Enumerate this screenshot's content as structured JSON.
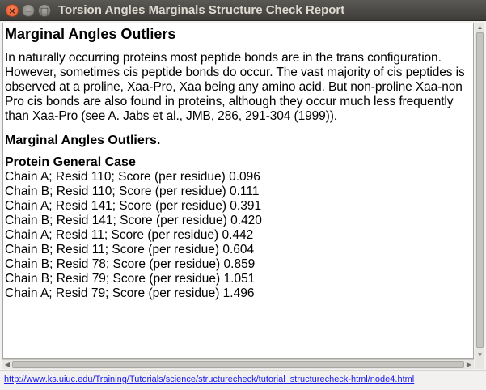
{
  "window": {
    "title": "Torsion Angles Marginals Structure Check Report"
  },
  "content": {
    "heading": "Marginal Angles Outliers",
    "paragraph": "In naturally occurring proteins most peptide bonds are in the trans configuration. However, sometimes cis peptide bonds do occur. The vast majority of cis peptides is observed at a proline, Xaa-Pro, Xaa being any amino acid. But non-proline Xaa-non Pro cis bonds are also found in proteins, although they occur much less frequently than Xaa-Pro (see A. Jabs et al., JMB, 286, 291-304 (1999)).",
    "subheading": "Marginal Angles Outliers.",
    "section_title": "Protein General Case",
    "outliers": [
      "Chain A; Resid 110; Score (per residue) 0.096",
      "Chain B; Resid 110; Score (per residue) 0.111",
      "Chain A; Resid 141; Score (per residue) 0.391",
      "Chain B; Resid 141; Score (per residue) 0.420",
      "Chain A; Resid 11; Score (per residue) 0.442",
      "Chain B; Resid 11; Score (per residue) 0.604",
      "Chain B; Resid 78; Score (per residue) 0.859",
      "Chain B; Resid 79; Score (per residue) 1.051",
      "Chain A; Resid 79; Score (per residue) 1.496"
    ]
  },
  "statusbar": {
    "link": "http://www.ks.uiuc.edu/Training/Tutorials/science/structurecheck/tutorial_structurecheck-html/node4.html"
  },
  "icons": {
    "close": "×",
    "minimize": "−",
    "maximize": "□"
  }
}
